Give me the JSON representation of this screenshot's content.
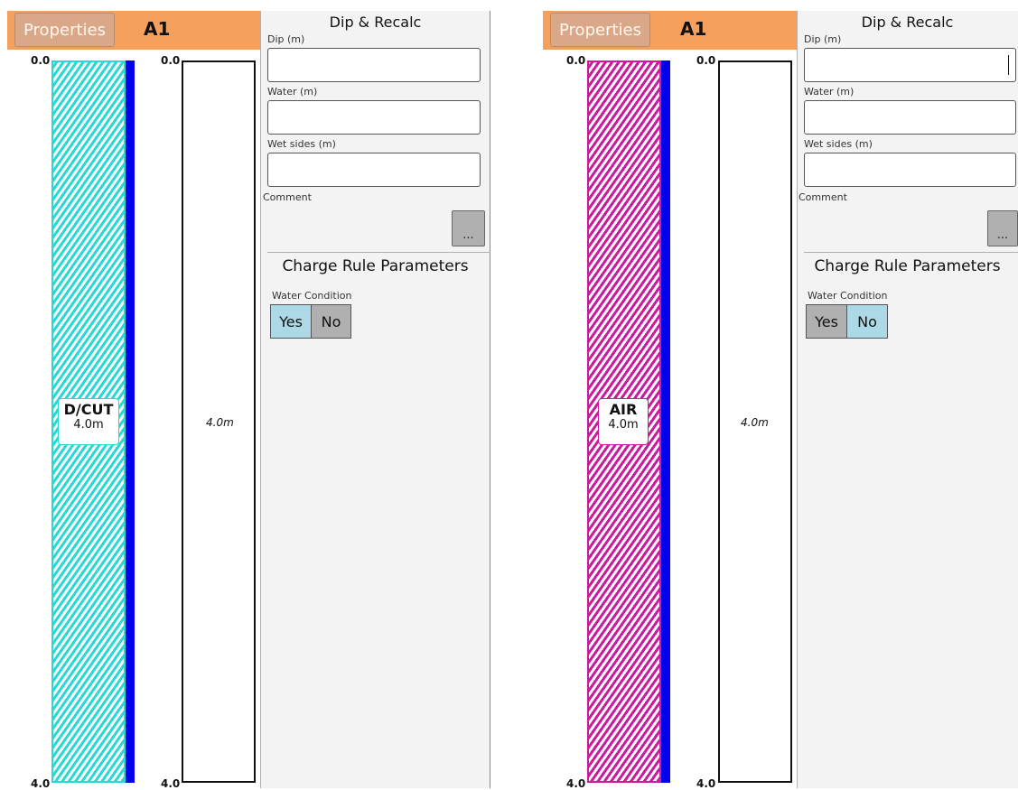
{
  "panels": [
    {
      "properties_label": "Properties",
      "hole_id": "A1",
      "axis_top": "0.0",
      "axis_bottom": "4.0",
      "material_name": "D/CUT",
      "material_length": "4.0m",
      "material_color": "#27d8d4",
      "column_depth_label": "4.0m",
      "dip_title": "Dip & Recalc",
      "dip_label": "Dip (m)",
      "dip_value": "",
      "water_label": "Water (m)",
      "water_value": "",
      "wet_label": "Wet sides (m)",
      "wet_value": "",
      "comment_label": "Comment",
      "dots_label": "...",
      "charge_title": "Charge Rule Parameters",
      "water_condition_label": "Water Condition",
      "yes_label": "Yes",
      "no_label": "No",
      "water_condition_selected": "Yes"
    },
    {
      "properties_label": "Properties",
      "hole_id": "A1",
      "axis_top": "0.0",
      "axis_bottom": "4.0",
      "material_name": "AIR",
      "material_length": "4.0m",
      "material_color": "#cc1a9e",
      "column_depth_label": "4.0m",
      "dip_title": "Dip & Recalc",
      "dip_label": "Dip (m)",
      "dip_value": "",
      "water_label": "Water (m)",
      "water_value": "",
      "wet_label": "Wet sides (m)",
      "wet_value": "",
      "comment_label": "Comment",
      "dots_label": "...",
      "charge_title": "Charge Rule Parameters",
      "water_condition_label": "Water Condition",
      "yes_label": "Yes",
      "no_label": "No",
      "water_condition_selected": "No"
    }
  ]
}
